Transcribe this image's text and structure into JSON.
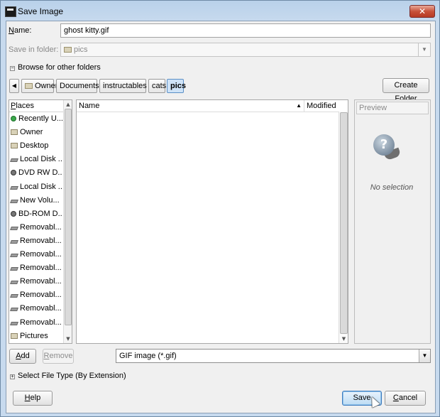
{
  "window": {
    "title": "Save Image",
    "close_label": "✕"
  },
  "name": {
    "label_underlined": "N",
    "label_rest": "ame:",
    "value": "ghost kitty.gif"
  },
  "save_in": {
    "label": "Save in folder:",
    "value": "pics"
  },
  "browse": {
    "label": "Browse for other folders",
    "expander": "⊟"
  },
  "breadcrumbs": [
    {
      "label": "Owner"
    },
    {
      "label": "Documents"
    },
    {
      "label": "instructables"
    },
    {
      "label": "cats"
    },
    {
      "label": "pics"
    }
  ],
  "create_folder": {
    "label_pre": "Create Fo",
    "label_u": "l",
    "label_post": "der"
  },
  "places": {
    "header_u": "P",
    "header_rest": "laces",
    "items": [
      {
        "label": "Recently U...",
        "icon": "recent-icon"
      },
      {
        "label": "Owner",
        "icon": "folder-icon"
      },
      {
        "label": "Desktop",
        "icon": "folder-icon"
      },
      {
        "label": "Local Disk ...",
        "icon": "drive-icon"
      },
      {
        "label": "DVD RW D...",
        "icon": "dvd-icon"
      },
      {
        "label": "Local Disk ...",
        "icon": "drive-icon"
      },
      {
        "label": "New Volu...",
        "icon": "drive-icon"
      },
      {
        "label": "BD-ROM D...",
        "icon": "dvd-icon"
      },
      {
        "label": "Removabl...",
        "icon": "drive-icon"
      },
      {
        "label": "Removabl...",
        "icon": "drive-icon"
      },
      {
        "label": "Removabl...",
        "icon": "drive-icon"
      },
      {
        "label": "Removabl...",
        "icon": "drive-icon"
      },
      {
        "label": "Removabl...",
        "icon": "drive-icon"
      },
      {
        "label": "Removabl...",
        "icon": "drive-icon"
      },
      {
        "label": "Removabl...",
        "icon": "drive-icon"
      },
      {
        "label": "Removabl...",
        "icon": "drive-icon"
      },
      {
        "label": "Pictures",
        "icon": "folder-icon"
      }
    ]
  },
  "files": {
    "col_name": "Name",
    "col_modified": "Modified",
    "sort_indicator": "▲"
  },
  "preview": {
    "header": "Preview",
    "empty_text": "No selection"
  },
  "add_button": {
    "u": "A",
    "rest": "dd"
  },
  "remove_button": {
    "u": "R",
    "rest": "emove"
  },
  "file_type": {
    "value": "GIF image (*.gif)"
  },
  "select_type": {
    "label": "Select File Type (By Extension)",
    "expander": "⊞"
  },
  "help_button": {
    "u": "H",
    "rest": "elp"
  },
  "save_button": {
    "label": "Save"
  },
  "cancel_button": {
    "u": "C",
    "rest": "ancel"
  }
}
